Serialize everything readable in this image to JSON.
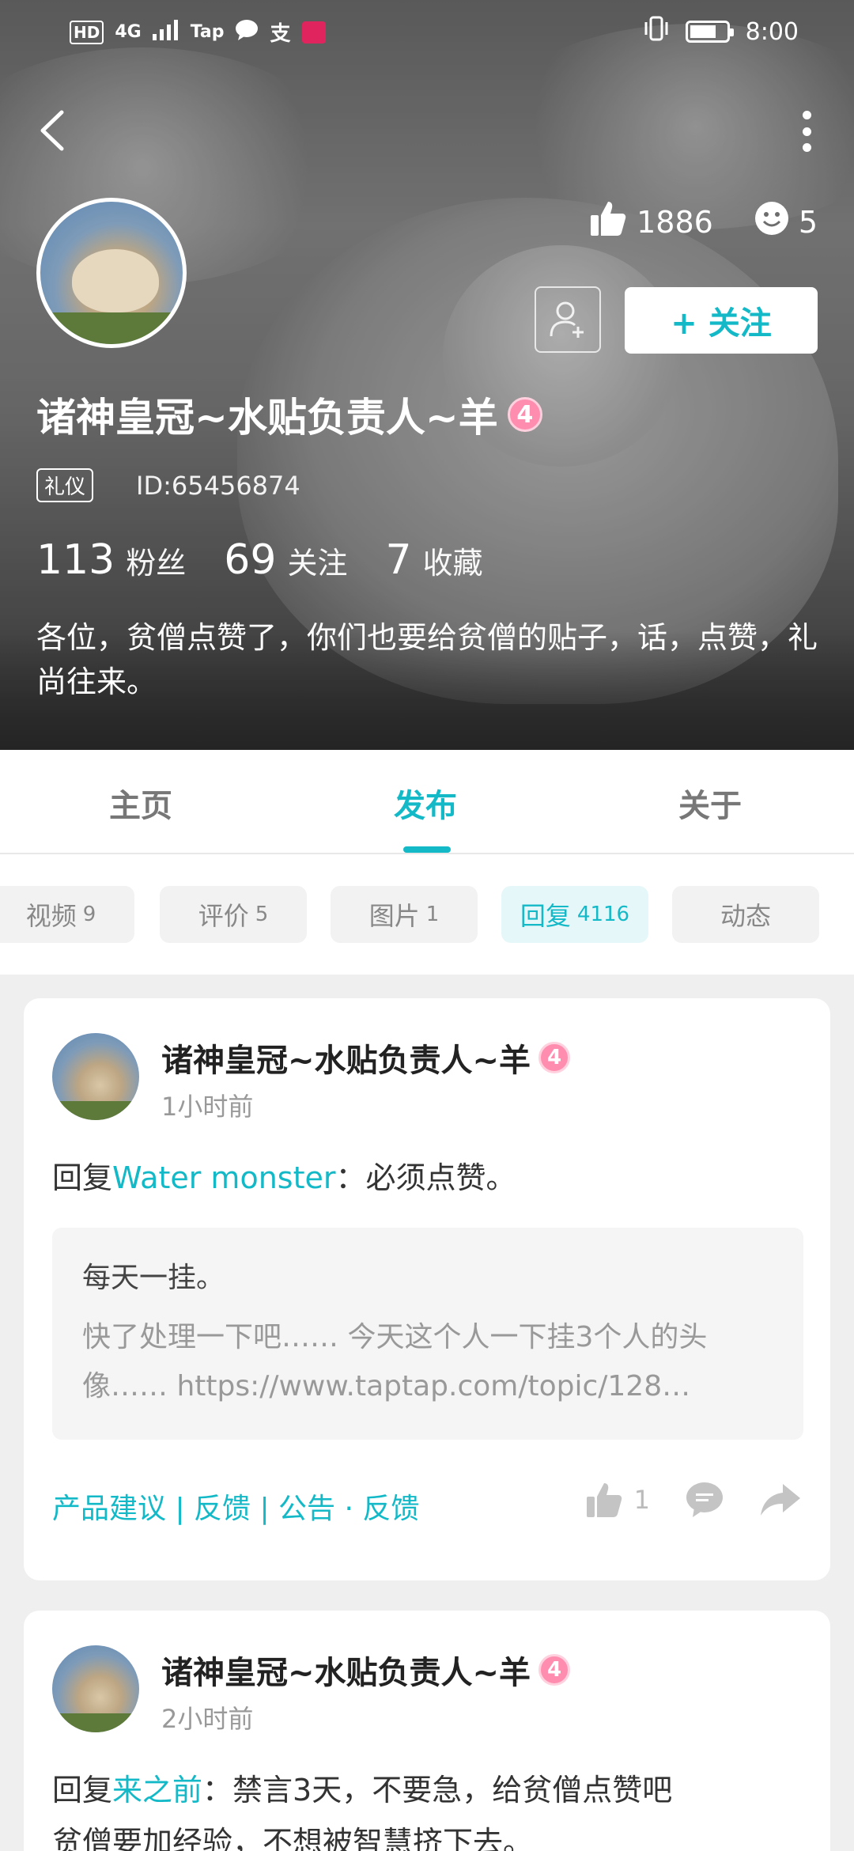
{
  "status_bar": {
    "left_indicators": [
      "HD",
      "4G",
      "Tap"
    ],
    "time": "8:00"
  },
  "header": {
    "likes": "1886",
    "reactions": "5",
    "username": "诸神皇冠~水贴负责人~羊",
    "level": "4",
    "tag": "礼仪",
    "user_id": "ID:65456874",
    "follow_button": "+ 关注",
    "counts": [
      {
        "value": "113",
        "label": "粉丝"
      },
      {
        "value": "69",
        "label": "关注"
      },
      {
        "value": "7",
        "label": "收藏"
      }
    ],
    "bio": "各位，贫僧点赞了，你们也要给贫僧的贴子，话，点赞，礼尚往来。"
  },
  "tabs": [
    {
      "label": "主页"
    },
    {
      "label": "发布"
    },
    {
      "label": "关于"
    }
  ],
  "subtabs": [
    {
      "label": "视频",
      "count": "9"
    },
    {
      "label": "评价",
      "count": "5"
    },
    {
      "label": "图片",
      "count": "1"
    },
    {
      "label": "回复",
      "count": "4116"
    },
    {
      "label": "动态",
      "count": ""
    }
  ],
  "posts": [
    {
      "author": "诸神皇冠~水贴负责人~羊",
      "level": "4",
      "time": "1小时前",
      "reply_prefix": "回复",
      "reply_to": "Water monster",
      "reply_text": "：必须点赞。",
      "quote_title": "每天一挂。",
      "quote_body": "快了处理一下吧…… 今天这个人一下挂3个人的头像…… https://www.taptap.com/topic/128…",
      "footer_tags": "产品建议 | 反馈 | 公告 · 反馈",
      "like_count": "1"
    },
    {
      "author": "诸神皇冠~水贴负责人~羊",
      "level": "4",
      "time": "2小时前",
      "reply_prefix": "回复",
      "reply_to": "来之前",
      "reply_text": "：禁言3天，不要急，给贫僧点赞吧",
      "reply_text_line2": "贫僧要加经验，不想被智慧挤下去。"
    }
  ],
  "colors": {
    "accent": "#14b9c8",
    "level_badge": "#ff8db0"
  }
}
